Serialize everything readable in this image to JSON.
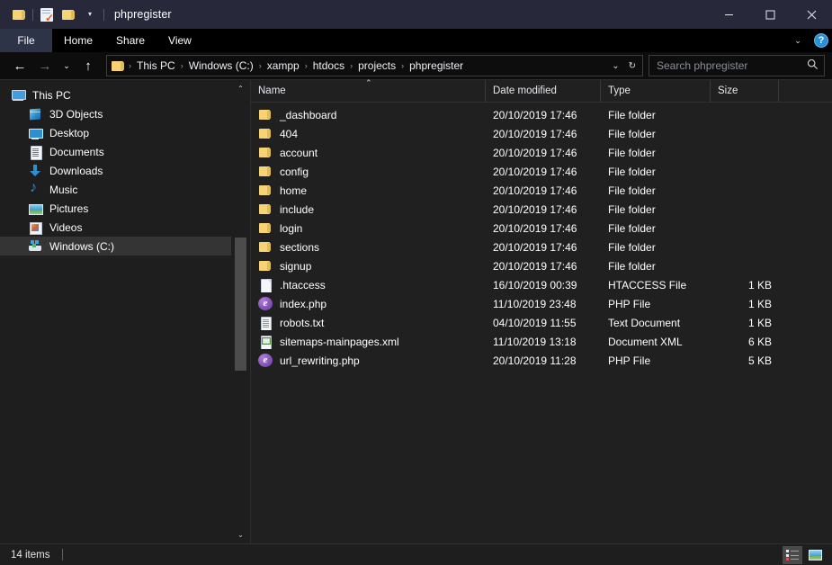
{
  "window": {
    "title": "phpregister",
    "quick_access": [
      {
        "name": "folder-icon",
        "label": "Folder"
      },
      {
        "name": "properties-icon",
        "label": "Properties"
      },
      {
        "name": "new-folder-icon",
        "label": "New folder"
      }
    ],
    "qat_dropdown": "▾",
    "controls": {
      "minimize": "Minimize",
      "maximize": "Maximize",
      "close": "Close"
    }
  },
  "ribbon": {
    "tabs": [
      {
        "label": "File",
        "active": true
      },
      {
        "label": "Home",
        "active": false
      },
      {
        "label": "Share",
        "active": false
      },
      {
        "label": "View",
        "active": false
      }
    ],
    "expand_chevron": "⌄",
    "help_label": "?"
  },
  "address": {
    "back": "←",
    "forward": "→",
    "recent": "⌄",
    "up": "↑",
    "crumbs": [
      "This PC",
      "Windows (C:)",
      "xampp",
      "htdocs",
      "projects",
      "phpregister"
    ],
    "crumb_separator": "›",
    "dropdown": "⌄",
    "refresh": "↻"
  },
  "search": {
    "placeholder": "Search phpregister",
    "value": "",
    "icon": "search-icon"
  },
  "sidebar": {
    "items": [
      {
        "label": "This PC",
        "icon": "computer-icon",
        "indent": 0,
        "selected": false
      },
      {
        "label": "3D Objects",
        "icon": "cube-icon",
        "indent": 1,
        "selected": false
      },
      {
        "label": "Desktop",
        "icon": "desktop-icon",
        "indent": 1,
        "selected": false
      },
      {
        "label": "Documents",
        "icon": "document-icon",
        "indent": 1,
        "selected": false
      },
      {
        "label": "Downloads",
        "icon": "download-arrow-icon",
        "indent": 1,
        "selected": false
      },
      {
        "label": "Music",
        "icon": "music-note-icon",
        "indent": 1,
        "selected": false
      },
      {
        "label": "Pictures",
        "icon": "picture-icon",
        "indent": 1,
        "selected": false
      },
      {
        "label": "Videos",
        "icon": "video-icon",
        "indent": 1,
        "selected": false
      },
      {
        "label": "Windows (C:)",
        "icon": "hard-drive-icon",
        "indent": 1,
        "selected": true
      }
    ],
    "scroll_up": "⌃",
    "scroll_down": "⌄"
  },
  "filelist": {
    "columns": [
      {
        "key": "name",
        "label": "Name",
        "sorted": "asc"
      },
      {
        "key": "date",
        "label": "Date modified",
        "sorted": null
      },
      {
        "key": "type",
        "label": "Type",
        "sorted": null
      },
      {
        "key": "size",
        "label": "Size",
        "sorted": null
      }
    ],
    "sort_caret": "⌃",
    "rows": [
      {
        "name": "_dashboard",
        "date": "20/10/2019 17:46",
        "type": "File folder",
        "size": "",
        "icon": "folder-icon"
      },
      {
        "name": "404",
        "date": "20/10/2019 17:46",
        "type": "File folder",
        "size": "",
        "icon": "folder-icon"
      },
      {
        "name": "account",
        "date": "20/10/2019 17:46",
        "type": "File folder",
        "size": "",
        "icon": "folder-icon"
      },
      {
        "name": "config",
        "date": "20/10/2019 17:46",
        "type": "File folder",
        "size": "",
        "icon": "folder-icon"
      },
      {
        "name": "home",
        "date": "20/10/2019 17:46",
        "type": "File folder",
        "size": "",
        "icon": "folder-icon"
      },
      {
        "name": "include",
        "date": "20/10/2019 17:46",
        "type": "File folder",
        "size": "",
        "icon": "folder-icon"
      },
      {
        "name": "login",
        "date": "20/10/2019 17:46",
        "type": "File folder",
        "size": "",
        "icon": "folder-icon"
      },
      {
        "name": "sections",
        "date": "20/10/2019 17:46",
        "type": "File folder",
        "size": "",
        "icon": "folder-icon"
      },
      {
        "name": "signup",
        "date": "20/10/2019 17:46",
        "type": "File folder",
        "size": "",
        "icon": "folder-icon"
      },
      {
        "name": ".htaccess",
        "date": "16/10/2019 00:39",
        "type": "HTACCESS File",
        "size": "1 KB",
        "icon": "blank-file-icon"
      },
      {
        "name": "index.php",
        "date": "11/10/2019 23:48",
        "type": "PHP File",
        "size": "1 KB",
        "icon": "php-file-icon"
      },
      {
        "name": "robots.txt",
        "date": "04/10/2019 11:55",
        "type": "Text Document",
        "size": "1 KB",
        "icon": "text-file-icon"
      },
      {
        "name": "sitemaps-mainpages.xml",
        "date": "11/10/2019 13:18",
        "type": "Document XML",
        "size": "6 KB",
        "icon": "xml-file-icon"
      },
      {
        "name": "url_rewriting.php",
        "date": "20/10/2019 11:28",
        "type": "PHP File",
        "size": "5 KB",
        "icon": "php-file-icon"
      }
    ]
  },
  "statusbar": {
    "item_count": "14 items",
    "views": [
      {
        "name": "details-view-button",
        "active": true
      },
      {
        "name": "large-icons-view-button",
        "active": false
      }
    ]
  },
  "colors": {
    "titlebar": "#27293a",
    "ribbon": "#000000",
    "address_bar": "#0d0d0d",
    "sidebar": "#1e1e1e",
    "file_list": "#202020",
    "accent_folder": "#f6d374",
    "selection": "#343434",
    "help_blue": "#2b8fd8",
    "php_purple": "#7b4fb0"
  }
}
